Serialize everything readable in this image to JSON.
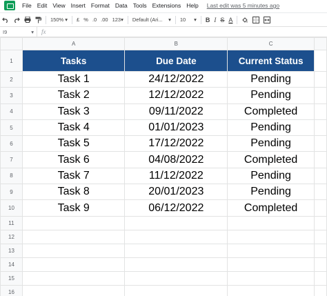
{
  "menu": {
    "items": [
      "File",
      "Edit",
      "View",
      "Insert",
      "Format",
      "Data",
      "Tools",
      "Extensions",
      "Help"
    ],
    "last_edit": "Last edit was 5 minutes ago"
  },
  "toolbar": {
    "zoom": "150%",
    "currency": "£",
    "percent": "%",
    "decrease_decimal": ".0",
    "increase_decimal": ".00",
    "number_format": "123",
    "font": "Default (Ari...",
    "font_size": "10",
    "bold": "B",
    "italic": "I",
    "strike": "S",
    "text_color": "A"
  },
  "formula_bar": {
    "name_box": "I9",
    "fx": "fx"
  },
  "sheet": {
    "columns": [
      "A",
      "B",
      "C"
    ],
    "row_numbers": [
      "1",
      "2",
      "3",
      "4",
      "5",
      "6",
      "7",
      "8",
      "9",
      "10",
      "11",
      "12",
      "13",
      "14",
      "15",
      "16"
    ],
    "header": [
      "Tasks",
      "Due Date",
      "Current Status"
    ],
    "rows": [
      [
        "Task 1",
        "24/12/2022",
        "Pending"
      ],
      [
        "Task 2",
        "12/12/2022",
        "Pending"
      ],
      [
        "Task 3",
        "09/11/2022",
        "Completed"
      ],
      [
        "Task 4",
        "01/01/2023",
        "Pending"
      ],
      [
        "Task 5",
        "17/12/2022",
        "Pending"
      ],
      [
        "Task 6",
        "04/08/2022",
        "Completed"
      ],
      [
        "Task 7",
        "11/12/2022",
        "Pending"
      ],
      [
        "Task 8",
        "20/01/2023",
        "Pending"
      ],
      [
        "Task 9",
        "06/12/2022",
        "Completed"
      ]
    ],
    "header_color": "#1c4f8d"
  }
}
